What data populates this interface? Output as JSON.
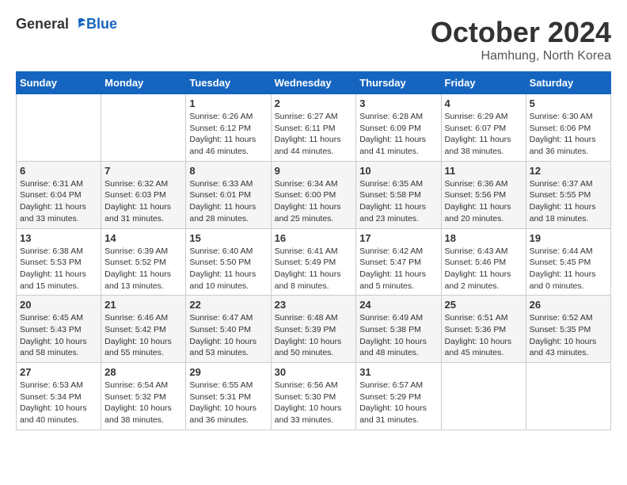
{
  "header": {
    "logo": {
      "general": "General",
      "blue": "Blue"
    },
    "title": "October 2024",
    "location": "Hamhung, North Korea"
  },
  "calendar": {
    "days_of_week": [
      "Sunday",
      "Monday",
      "Tuesday",
      "Wednesday",
      "Thursday",
      "Friday",
      "Saturday"
    ],
    "weeks": [
      [
        {
          "day": "",
          "info": ""
        },
        {
          "day": "",
          "info": ""
        },
        {
          "day": "1",
          "info": "Sunrise: 6:26 AM\nSunset: 6:12 PM\nDaylight: 11 hours\nand 46 minutes."
        },
        {
          "day": "2",
          "info": "Sunrise: 6:27 AM\nSunset: 6:11 PM\nDaylight: 11 hours\nand 44 minutes."
        },
        {
          "day": "3",
          "info": "Sunrise: 6:28 AM\nSunset: 6:09 PM\nDaylight: 11 hours\nand 41 minutes."
        },
        {
          "day": "4",
          "info": "Sunrise: 6:29 AM\nSunset: 6:07 PM\nDaylight: 11 hours\nand 38 minutes."
        },
        {
          "day": "5",
          "info": "Sunrise: 6:30 AM\nSunset: 6:06 PM\nDaylight: 11 hours\nand 36 minutes."
        }
      ],
      [
        {
          "day": "6",
          "info": "Sunrise: 6:31 AM\nSunset: 6:04 PM\nDaylight: 11 hours\nand 33 minutes."
        },
        {
          "day": "7",
          "info": "Sunrise: 6:32 AM\nSunset: 6:03 PM\nDaylight: 11 hours\nand 31 minutes."
        },
        {
          "day": "8",
          "info": "Sunrise: 6:33 AM\nSunset: 6:01 PM\nDaylight: 11 hours\nand 28 minutes."
        },
        {
          "day": "9",
          "info": "Sunrise: 6:34 AM\nSunset: 6:00 PM\nDaylight: 11 hours\nand 25 minutes."
        },
        {
          "day": "10",
          "info": "Sunrise: 6:35 AM\nSunset: 5:58 PM\nDaylight: 11 hours\nand 23 minutes."
        },
        {
          "day": "11",
          "info": "Sunrise: 6:36 AM\nSunset: 5:56 PM\nDaylight: 11 hours\nand 20 minutes."
        },
        {
          "day": "12",
          "info": "Sunrise: 6:37 AM\nSunset: 5:55 PM\nDaylight: 11 hours\nand 18 minutes."
        }
      ],
      [
        {
          "day": "13",
          "info": "Sunrise: 6:38 AM\nSunset: 5:53 PM\nDaylight: 11 hours\nand 15 minutes."
        },
        {
          "day": "14",
          "info": "Sunrise: 6:39 AM\nSunset: 5:52 PM\nDaylight: 11 hours\nand 13 minutes."
        },
        {
          "day": "15",
          "info": "Sunrise: 6:40 AM\nSunset: 5:50 PM\nDaylight: 11 hours\nand 10 minutes."
        },
        {
          "day": "16",
          "info": "Sunrise: 6:41 AM\nSunset: 5:49 PM\nDaylight: 11 hours\nand 8 minutes."
        },
        {
          "day": "17",
          "info": "Sunrise: 6:42 AM\nSunset: 5:47 PM\nDaylight: 11 hours\nand 5 minutes."
        },
        {
          "day": "18",
          "info": "Sunrise: 6:43 AM\nSunset: 5:46 PM\nDaylight: 11 hours\nand 2 minutes."
        },
        {
          "day": "19",
          "info": "Sunrise: 6:44 AM\nSunset: 5:45 PM\nDaylight: 11 hours\nand 0 minutes."
        }
      ],
      [
        {
          "day": "20",
          "info": "Sunrise: 6:45 AM\nSunset: 5:43 PM\nDaylight: 10 hours\nand 58 minutes."
        },
        {
          "day": "21",
          "info": "Sunrise: 6:46 AM\nSunset: 5:42 PM\nDaylight: 10 hours\nand 55 minutes."
        },
        {
          "day": "22",
          "info": "Sunrise: 6:47 AM\nSunset: 5:40 PM\nDaylight: 10 hours\nand 53 minutes."
        },
        {
          "day": "23",
          "info": "Sunrise: 6:48 AM\nSunset: 5:39 PM\nDaylight: 10 hours\nand 50 minutes."
        },
        {
          "day": "24",
          "info": "Sunrise: 6:49 AM\nSunset: 5:38 PM\nDaylight: 10 hours\nand 48 minutes."
        },
        {
          "day": "25",
          "info": "Sunrise: 6:51 AM\nSunset: 5:36 PM\nDaylight: 10 hours\nand 45 minutes."
        },
        {
          "day": "26",
          "info": "Sunrise: 6:52 AM\nSunset: 5:35 PM\nDaylight: 10 hours\nand 43 minutes."
        }
      ],
      [
        {
          "day": "27",
          "info": "Sunrise: 6:53 AM\nSunset: 5:34 PM\nDaylight: 10 hours\nand 40 minutes."
        },
        {
          "day": "28",
          "info": "Sunrise: 6:54 AM\nSunset: 5:32 PM\nDaylight: 10 hours\nand 38 minutes."
        },
        {
          "day": "29",
          "info": "Sunrise: 6:55 AM\nSunset: 5:31 PM\nDaylight: 10 hours\nand 36 minutes."
        },
        {
          "day": "30",
          "info": "Sunrise: 6:56 AM\nSunset: 5:30 PM\nDaylight: 10 hours\nand 33 minutes."
        },
        {
          "day": "31",
          "info": "Sunrise: 6:57 AM\nSunset: 5:29 PM\nDaylight: 10 hours\nand 31 minutes."
        },
        {
          "day": "",
          "info": ""
        },
        {
          "day": "",
          "info": ""
        }
      ]
    ]
  }
}
